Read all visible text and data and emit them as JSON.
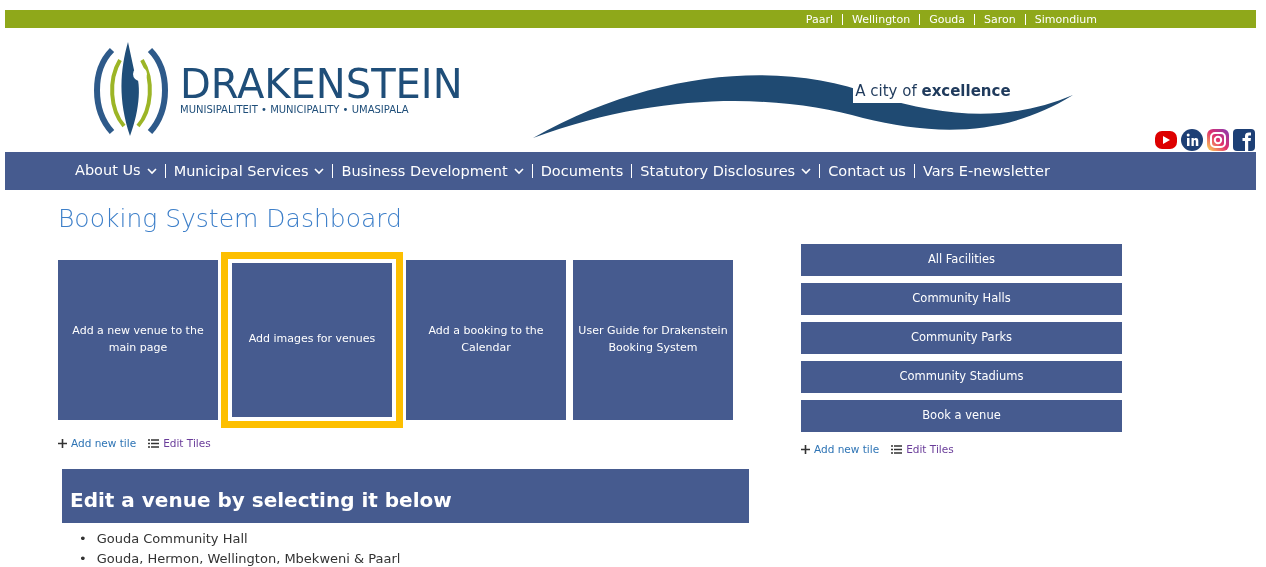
{
  "top_links": [
    "Paarl",
    "Wellington",
    "Gouda",
    "Saron",
    "Simondium"
  ],
  "logo": {
    "name": "DRAKENSTEIN",
    "subtitle": "MUNISIPALITEIT • MUNICIPALITY • UMASIPALA"
  },
  "tagline": "A city of **excellence**",
  "nav": [
    {
      "label": "About Us",
      "has_menu": true
    },
    {
      "label": "Municipal Services",
      "has_menu": true
    },
    {
      "label": "Business Development",
      "has_menu": true
    },
    {
      "label": "Documents",
      "has_menu": false
    },
    {
      "label": "Statutory Disclosures",
      "has_menu": true
    },
    {
      "label": "Contact us",
      "has_menu": false
    },
    {
      "label": "Vars E-newsletter",
      "has_menu": false
    }
  ],
  "title": "Booking System Dashboard",
  "tiles": [
    {
      "label": "Add a new venue to the main page",
      "highlighted": false
    },
    {
      "label": "Add images for venues",
      "highlighted": true
    },
    {
      "label": "Add a booking to the Calendar",
      "highlighted": false
    },
    {
      "label": "User Guide for Drakenstein Booking System",
      "highlighted": false
    }
  ],
  "tile_actions": {
    "add": "Add new tile",
    "edit": "Edit Tiles"
  },
  "side_buttons": [
    "All Facilities",
    "Community Halls",
    "Community Parks",
    "Community Stadiums",
    "Book a venue"
  ],
  "side_actions": {
    "add": "Add new tile",
    "edit": "Edit Tiles"
  },
  "venue_heading": "Edit a venue by selecting it below",
  "venues": [
    {
      "bullet": "•",
      "label": "Gouda Community Hall"
    },
    {
      "bullet": "•",
      "label": "Gouda, Hermon, Wellington, Mbekweni & Paarl"
    }
  ]
}
